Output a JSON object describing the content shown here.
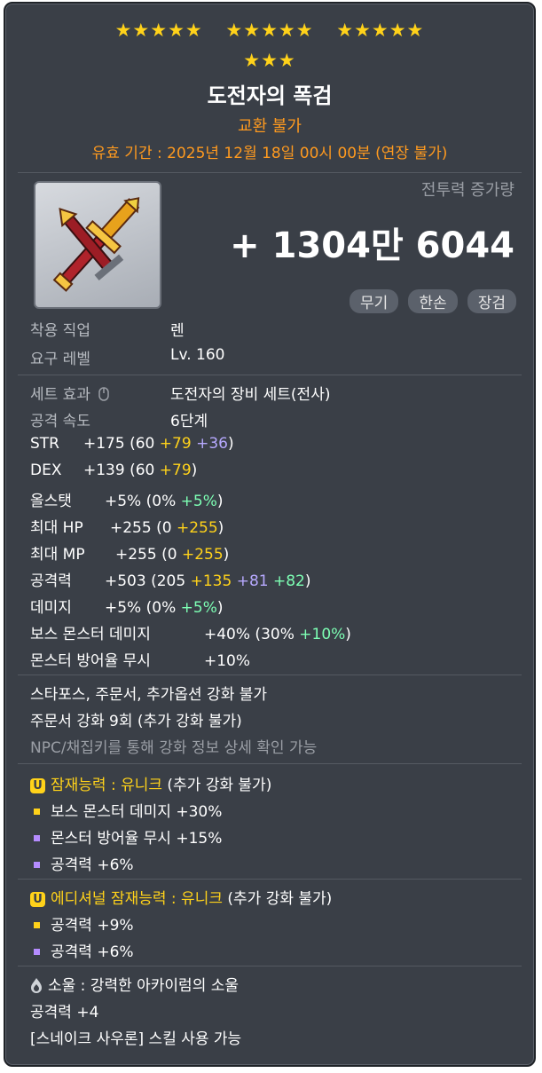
{
  "stars": {
    "row1": [
      "★★★★★",
      "★★★★★",
      "★★★★★"
    ],
    "row2": "★★★"
  },
  "item": {
    "name": "도전자의 폭검",
    "trade": "교환 불가",
    "expire": "유효 기간 : 2025년 12월 18일 00시 00분 (연장 불가)"
  },
  "combat_power": {
    "label": "전투력 증가량",
    "value": "+ 1304만 6044"
  },
  "tags": [
    "무기",
    "한손",
    "장검"
  ],
  "requirements": [
    {
      "label": "착용 직업",
      "value": "렌"
    },
    {
      "label": "요구 레벨",
      "value": "Lv. 160"
    }
  ],
  "set_effect": {
    "label": "세트 효과",
    "value": "도전자의 장비 세트(전사)"
  },
  "attack_speed": {
    "label": "공격 속도",
    "value": "6단계"
  },
  "stats": [
    {
      "name": "STR",
      "total": "+175",
      "open": " (60 ",
      "a": "+79",
      "b": " +36",
      "c": "",
      "close": ")"
    },
    {
      "name": "DEX",
      "total": "+139",
      "open": " (60 ",
      "a": "+79",
      "b": "",
      "c": "",
      "close": ")"
    },
    {
      "name": "올스탯",
      "total": "+5%",
      "open": " (0% ",
      "a": "",
      "b": "",
      "c": "+5%",
      "close": ")"
    },
    {
      "name": "최대 HP",
      "total": "+255",
      "open": " (0 ",
      "a": "+255",
      "b": "",
      "c": "",
      "close": ")"
    },
    {
      "name": "최대 MP",
      "total": "+255",
      "open": " (0 ",
      "a": "+255",
      "b": "",
      "c": "",
      "close": ")"
    },
    {
      "name": "공격력",
      "total": "+503",
      "open": " (205 ",
      "a": "+135",
      "b": " +81",
      "c": " +82",
      "close": ")"
    },
    {
      "name": "데미지",
      "total": "+5%",
      "open": " (0% ",
      "a": "",
      "b": "",
      "c": "+5%",
      "close": ")"
    },
    {
      "name": "보스 몬스터 데미지",
      "total": "+40%",
      "open": " (30% ",
      "a": "",
      "b": "",
      "c": "+10%",
      "close": ")"
    },
    {
      "name": "몬스터 방어율 무시",
      "total": "+10%",
      "open": "",
      "a": "",
      "b": "",
      "c": "",
      "close": ""
    }
  ],
  "notes": [
    "스타포스, 주문서, 추가옵션 강화 불가",
    "주문서 강화 9회 (추가 강화 불가)"
  ],
  "npc_note": "NPC/채집키를 통해 강화 정보 상세 확인 가능",
  "potential": {
    "badge": "U",
    "title": "잠재능력 : 유니크",
    "suffix": " (추가 강화 불가)",
    "lines": [
      {
        "color": "yellow",
        "text": "보스 몬스터 데미지 +30%"
      },
      {
        "color": "purple",
        "text": "몬스터 방어율 무시 +15%"
      },
      {
        "color": "purple",
        "text": "공격력 +6%"
      }
    ]
  },
  "additional_potential": {
    "badge": "U",
    "title": "에디셔널 잠재능력 : 유니크",
    "suffix": " (추가 강화 불가)",
    "lines": [
      {
        "color": "yellow",
        "text": "공격력 +9%"
      },
      {
        "color": "purple",
        "text": "공격력 +6%"
      }
    ]
  },
  "soul": {
    "icon": "soul-flame-icon",
    "title": "소울 : 강력한 아카이럼의 소울",
    "stat": "공격력 +4",
    "skill": "[스네이크 사우론] 스킬 사용 가능"
  },
  "colors": {
    "accent": "#ffd21a",
    "warn": "#ff9a1f",
    "purple": "#b7a9ff",
    "green": "#7dffb4",
    "panel": "#3a3f47"
  }
}
